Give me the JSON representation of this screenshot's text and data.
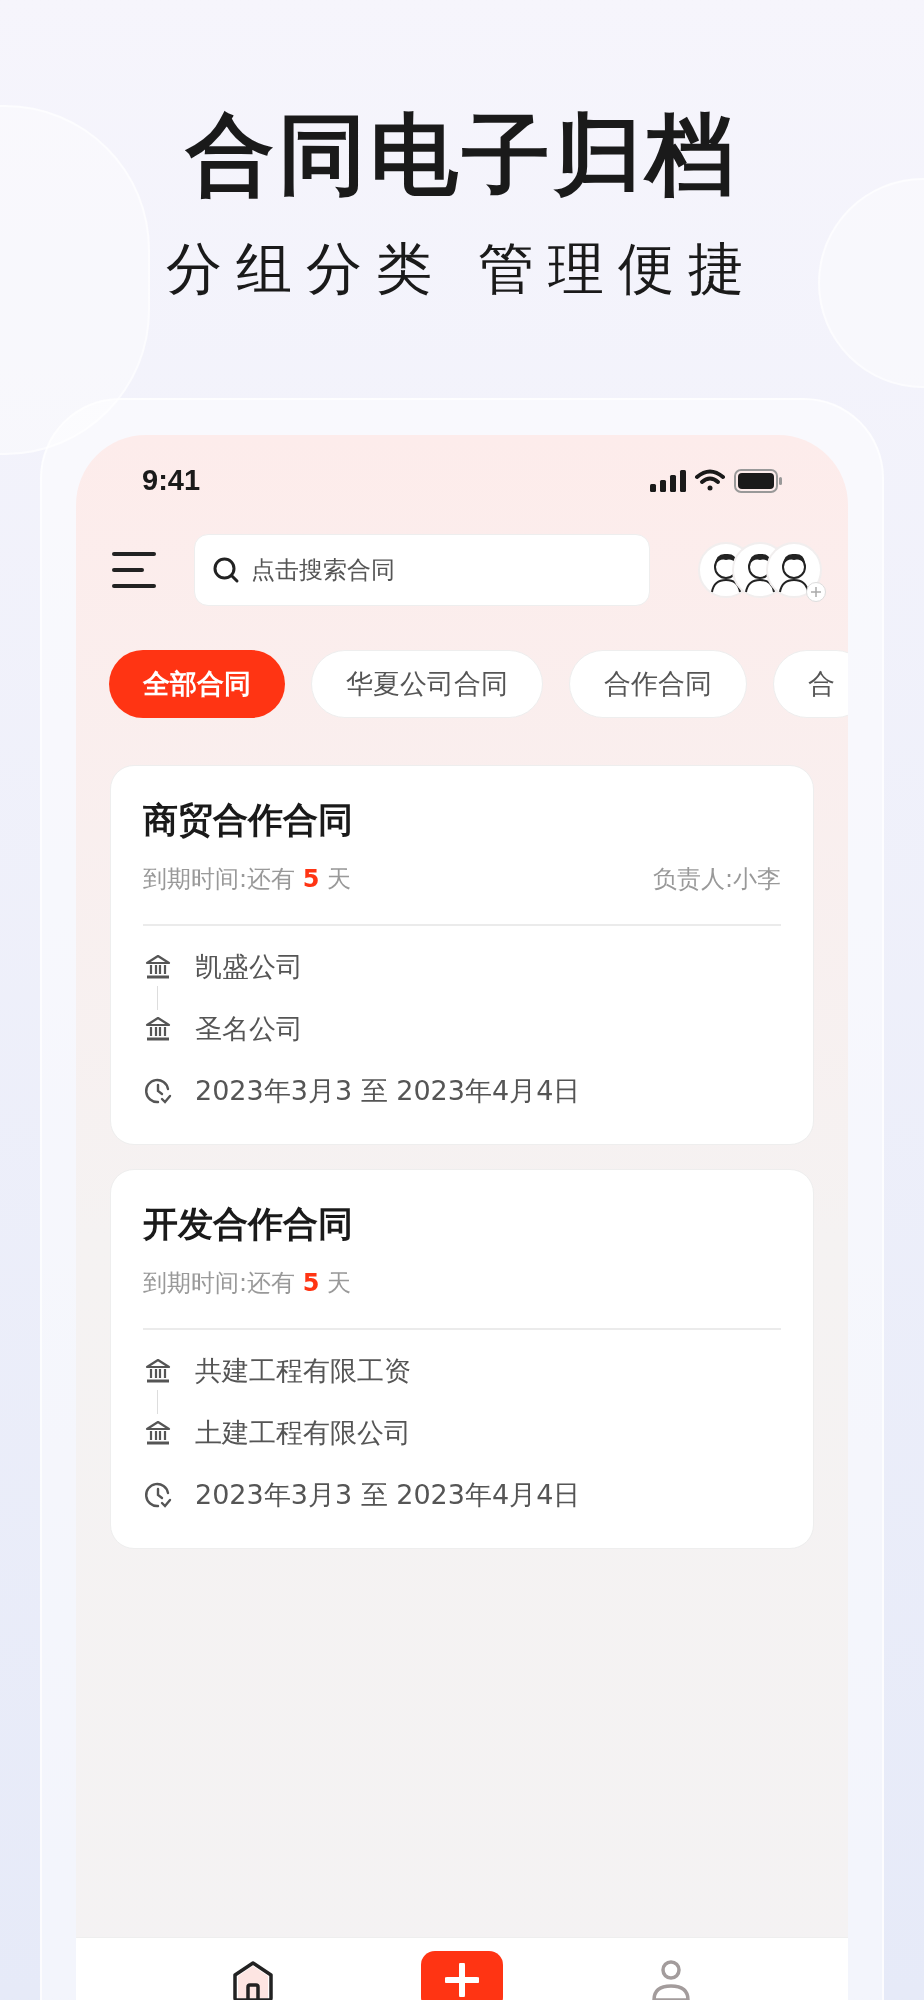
{
  "headline": {
    "title": "合同电子归档",
    "subtitle": "分组分类 管理便捷"
  },
  "status_bar": {
    "time": "9:41"
  },
  "search": {
    "placeholder": "点击搜索合同"
  },
  "tabs": [
    {
      "label": "全部合同",
      "selected": true
    },
    {
      "label": "华夏公司合同",
      "selected": false
    },
    {
      "label": "合作合同",
      "selected": false
    },
    {
      "label": "合",
      "selected": false
    }
  ],
  "contracts": [
    {
      "title": "商贸合作合同",
      "expiry_label": "到期时间:还有",
      "days": "5",
      "unit": "天",
      "owner": "负责人:小李",
      "parties": [
        "凯盛公司",
        "圣名公司"
      ],
      "period": "2023年3月3 至 2023年4月4日"
    },
    {
      "title": "开发合作合同",
      "expiry_label": "到期时间:还有",
      "days": "5",
      "unit": "天",
      "parties": [
        "共建工程有限工资",
        "土建工程有限公司"
      ],
      "period": "2023年3月3 至 2023年4月4日"
    }
  ],
  "bottom_nav": [
    {
      "kind": "home",
      "selected": true
    },
    {
      "kind": "add",
      "selected": false
    },
    {
      "kind": "profile",
      "selected": false
    }
  ]
}
